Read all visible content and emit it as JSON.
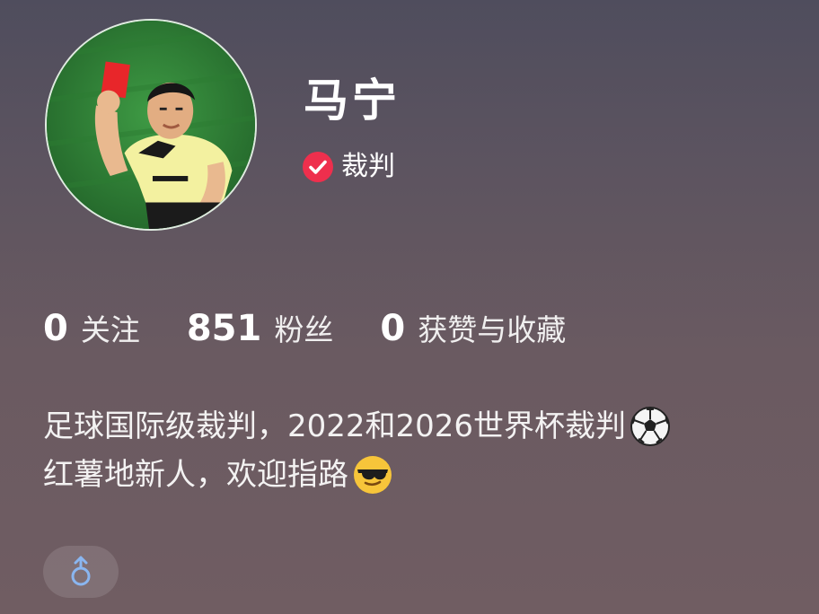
{
  "profile": {
    "name": "马宁",
    "verified_label": "裁判",
    "avatar_icon": "avatar-referee-red-card",
    "verified_icon": "check-badge-icon",
    "verified_color": "#ee2f4d"
  },
  "stats": {
    "following_count": "0",
    "following_label": "关注",
    "followers_count": "851",
    "followers_label": "粉丝",
    "likes_count": "0",
    "likes_label": "获赞与收藏"
  },
  "bio": {
    "line1": "足球国际级裁判，2022和2026世界杯裁判",
    "line1_emoji": "soccer-ball-icon",
    "line2": "红薯地新人，欢迎指路",
    "line2_emoji": "sunglasses-face-icon"
  },
  "gender": {
    "icon": "male-icon",
    "color": "#8ab6f0"
  }
}
